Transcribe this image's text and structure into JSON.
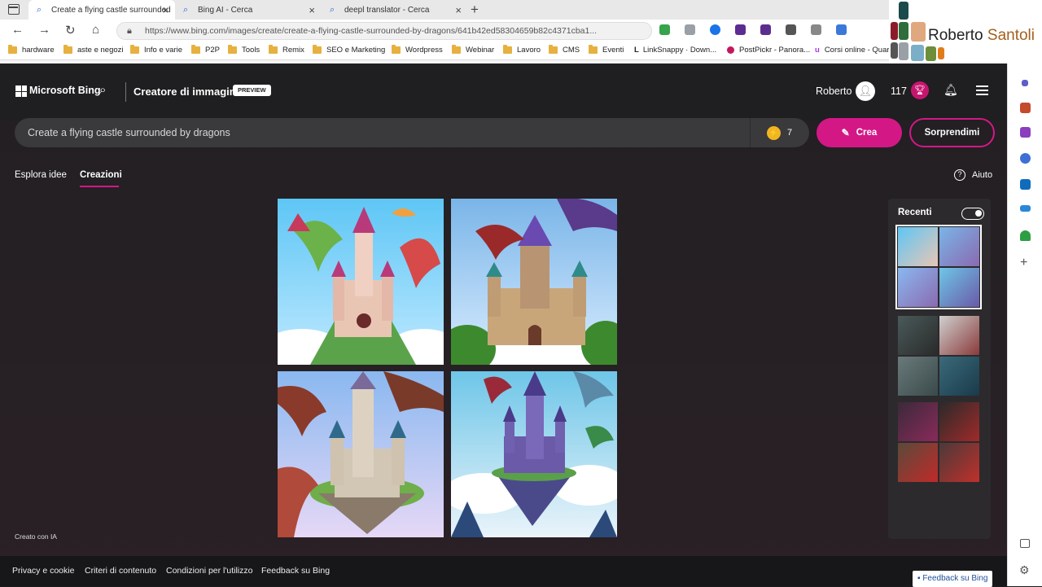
{
  "browser": {
    "tabs": [
      {
        "title": "Create a flying castle surrounded",
        "active": true
      },
      {
        "title": "Bing AI - Cerca",
        "active": false
      },
      {
        "title": "deepl translator - Cerca",
        "active": false
      }
    ],
    "url": "https://www.bing.com/images/create/create-a-flying-castle-surrounded-by-dragons/641b42ed58304659b82c4371cba1...",
    "bookmarks": [
      "hardware",
      "aste e negozi",
      "Info e varie",
      "P2P",
      "Tools",
      "Remix",
      "SEO e Marketing",
      "Wordpress",
      "Webinar",
      "Lavoro",
      "CMS",
      "Eventi",
      "LinkSnappy · Down...",
      "PostPickr - Panora...",
      "Corsi online - Quar"
    ]
  },
  "watermark": {
    "first": "Roberto",
    "last": "Santoli"
  },
  "header": {
    "brand": "Microsoft Bing",
    "title": "Creatore di immagini",
    "badge": "PREVIEW",
    "user": "Roberto",
    "points": "117"
  },
  "prompt": {
    "value": "Create a flying castle surrounded by dragons",
    "boosts": "7",
    "create_label": "Crea",
    "surprise_label": "Sorprendimi"
  },
  "subtabs": {
    "explore": "Esplora idee",
    "creations": "Creazioni",
    "help": "Aiuto"
  },
  "recent": {
    "title": "Recenti",
    "toggle_on": true
  },
  "created_with": "Creato con IA",
  "footer": {
    "links": [
      "Privacy e cookie",
      "Criteri di contenuto",
      "Condizioni per l'utilizzo",
      "Feedback su Bing"
    ],
    "feedback_button": "Feedback su Bing"
  },
  "colors": {
    "accent": "#d31886",
    "background": "#1f1e20"
  }
}
